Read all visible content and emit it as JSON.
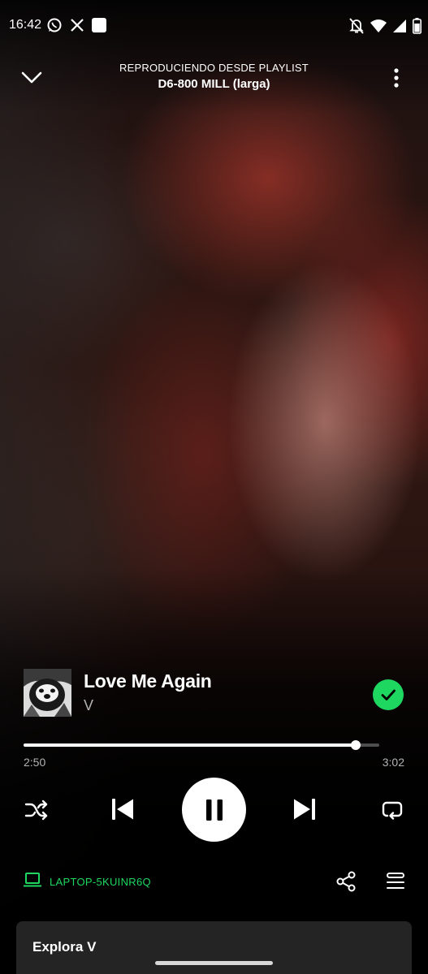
{
  "status_bar": {
    "time": "16:42",
    "left_icons": [
      "whatsapp-icon",
      "x-icon",
      "square-notification-icon"
    ],
    "right_icons": [
      "mute-bell-icon",
      "wifi-icon",
      "signal-icon",
      "battery-icon"
    ]
  },
  "header": {
    "context_label": "REPRODUCIENDO DESDE PLAYLIST",
    "playlist_name": "D6-800 MILL (larga)"
  },
  "track": {
    "title": "Love Me Again",
    "artist": "V",
    "liked": true
  },
  "playback": {
    "elapsed": "2:50",
    "total": "3:02",
    "progress": 0.934,
    "state": "playing"
  },
  "device": {
    "name": "LAPTOP-5KUINR6Q"
  },
  "explore": {
    "title": "Explora V"
  },
  "colors": {
    "accent": "#1ed760",
    "background": "#000000",
    "secondary_text": "#b3b3b3",
    "card": "#242424"
  }
}
